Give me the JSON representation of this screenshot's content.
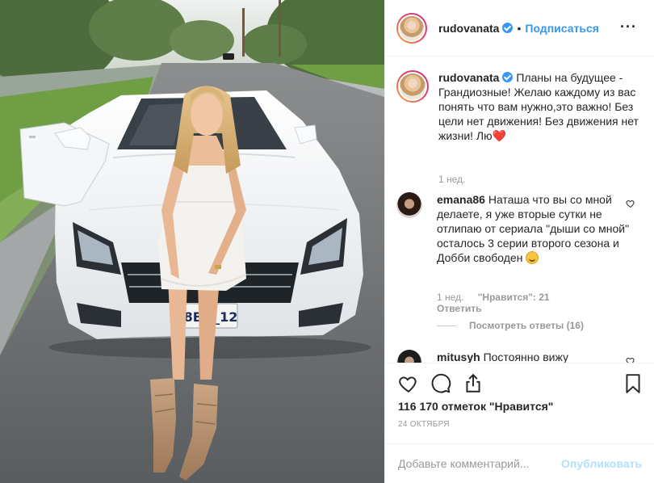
{
  "post": {
    "username": "rudovanata",
    "follow_label": "Подписаться",
    "dot": "•",
    "more_label": "···"
  },
  "caption": {
    "username": "rudovanata",
    "text": "Планы на будущее - Грандиозные! Желаю каждому из вас понять что вам нужно,это важно! Без цели нет движения! Без движения нет жизни! Лю",
    "emoji": "❤️",
    "time": "1 нед."
  },
  "comments": [
    {
      "username": "emana86",
      "text": "Наташа что вы со мной делаете, я уже вторые сутки не отлипаю от сериала \"дыши со мной\" осталось 3 серии второго сезона и Добби свободен",
      "time": "1 нед.",
      "likes": "\"Нравится\": 21",
      "reply": "Ответить",
      "view_replies": "Посмотреть ответы (16)"
    },
    {
      "username": "mitusyh",
      "text": "Постоянно вижу"
    }
  ],
  "stats": {
    "likes": "116 170 отметок \"Нравится\"",
    "date": "24 ОКТЯБРЯ"
  },
  "compose": {
    "placeholder": "Добавьте комментарий...",
    "publish_label": "Опубликовать"
  },
  "photo": {
    "plate_text": "8BD_12"
  },
  "colors": {
    "link_blue": "#3897f0",
    "publish_disabled": "#b2dffc",
    "muted": "#999999",
    "heart_red": "#e0245e"
  }
}
